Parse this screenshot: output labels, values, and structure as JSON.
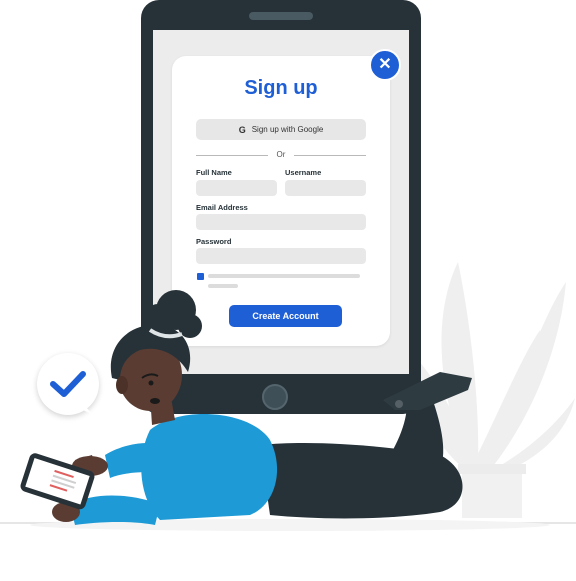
{
  "colors": {
    "accent": "#1f5fd6",
    "device": "#263238",
    "shirt": "#1e9ad6"
  },
  "signup": {
    "title": "Sign up",
    "google_label": "Sign up with Google",
    "or_label": "Or",
    "full_name_label": "Full Name",
    "username_label": "Username",
    "email_label": "Email Address",
    "password_label": "Password",
    "submit_label": "Create Account",
    "close_icon": "close-icon"
  },
  "icons": {
    "google": "google-icon",
    "check": "check-icon"
  }
}
